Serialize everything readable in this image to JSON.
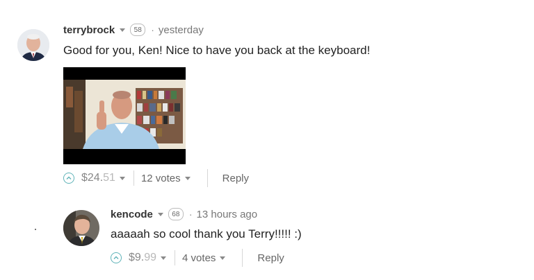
{
  "comments": [
    {
      "author": "terrybrock",
      "reputation": "58",
      "separator": "·",
      "timestamp": "yesterday",
      "body": "Good for you, Ken! Nice to have you back at the keyboard!",
      "has_image": true,
      "payout_whole": "$24.",
      "payout_cents": "51",
      "votes": "12 votes",
      "reply_label": "Reply"
    },
    {
      "author": "kencode",
      "reputation": "68",
      "separator": "·",
      "timestamp": "13 hours ago",
      "body": "aaaaah so cool thank you Terry!!!!! :)",
      "has_image": false,
      "payout_whole": "$9.",
      "payout_cents": "99",
      "votes": "4 votes",
      "reply_label": "Reply"
    }
  ],
  "icons": {
    "upvote": "upvote-chevron-icon",
    "caret": "caret-down-icon"
  },
  "colors": {
    "upvote_ring": "#5fb3b8",
    "payout_whole": "#888888",
    "payout_cents": "#b8b8b8",
    "muted_text": "#666666"
  }
}
